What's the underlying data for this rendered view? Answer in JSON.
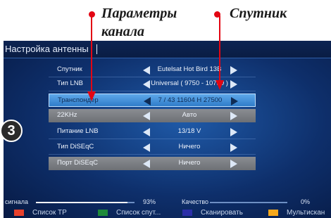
{
  "annotations": {
    "channel_params_line1": "Параметры",
    "channel_params_line2": "канала",
    "satellite": "Спутник"
  },
  "screen": {
    "title": "Настройка антенны",
    "step_badge": "3",
    "rows": [
      {
        "label": "Спутник",
        "value": "Eutelsat Hot Bird 13B"
      },
      {
        "label": "Тип LNB",
        "value": "Universal ( 9750 - 10750 )"
      },
      {
        "label": "Транспондер",
        "value": "7 / 43   11604  H  27500"
      },
      {
        "label": "22KHz",
        "value": "Авто"
      },
      {
        "label": "Питание LNB",
        "value": "13/18 V"
      },
      {
        "label": "Тип DiSEqC",
        "value": "Ничего"
      },
      {
        "label": "Порт DiSEqC",
        "value": "Ничего"
      }
    ],
    "signal": {
      "label": "сигнала",
      "value": "93%",
      "level": 0.93
    },
    "quality": {
      "label": "Качество",
      "value": "0%",
      "level": 0.0
    },
    "footer": [
      {
        "label": "Список TP",
        "color": "#e8412c"
      },
      {
        "label": "Список спут...",
        "color": "#1e8a3a"
      },
      {
        "label": "Сканировать",
        "color": "#2b2fa8"
      },
      {
        "label": "Мультискан",
        "color": "#f5a81c"
      }
    ]
  },
  "colors": {
    "accent_dot": "#e30613",
    "selected_row": "#4a94dc",
    "gray_row": "#7d8085"
  }
}
